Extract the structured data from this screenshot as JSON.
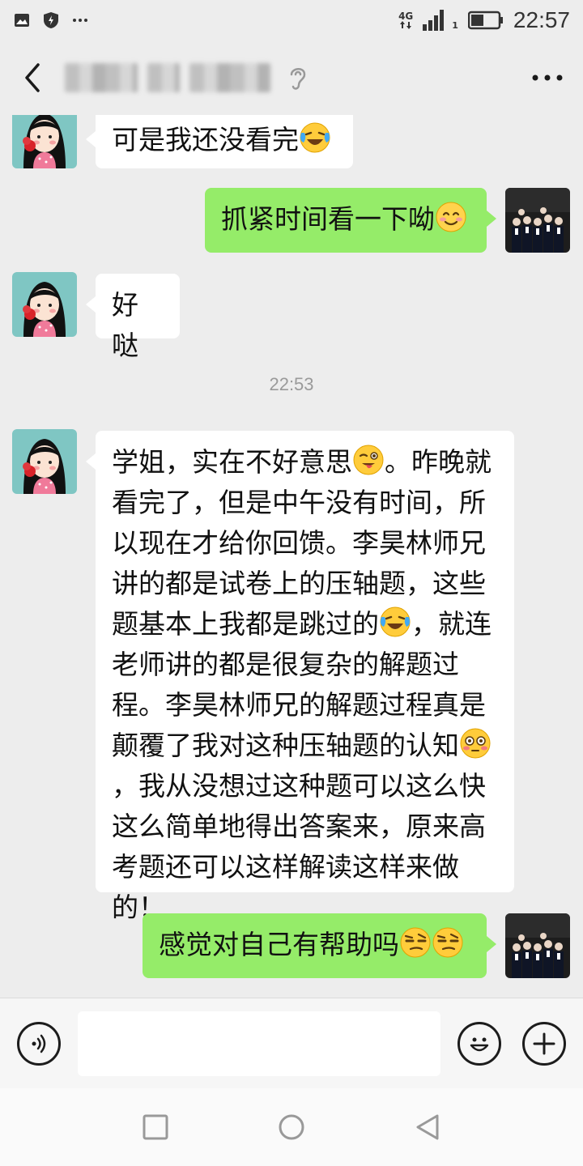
{
  "status_bar": {
    "left_icons": [
      "gallery-icon",
      "shield-bolt-icon",
      "more-dots-icon"
    ],
    "network": "4G",
    "signal_sub": "1",
    "time": "22:57"
  },
  "header": {
    "back_icon": "chevron-left-icon",
    "title_obscured": true,
    "ear_icon": "earpiece-icon",
    "more_icon": "ellipsis-icon"
  },
  "messages": [
    {
      "sender": "contact",
      "text": "可是我还没看完",
      "emoji": "crying-laughing"
    },
    {
      "sender": "me",
      "text": "抓紧时间看一下呦",
      "emoji": "smiling-blush"
    },
    {
      "sender": "contact",
      "text": "好哒"
    },
    {
      "type": "timestamp",
      "text": "22:53"
    },
    {
      "sender": "contact",
      "text_parts": [
        "学姐，实在不好意思",
        "。昨晚就看完了，但是中午没有时间，所以现在才给你回馈。李昊林师兄讲的都是试卷上的压轴题，这些题基本上我都是跳过的",
        "，就连老师讲的都是很复杂的解题过程。李昊林师兄的解题过程真是颠覆了我对这种压轴题的认知",
        "，我从没想过这种题可以这么快这么简单地得出答案来，原来高考题还可以这样解读这样来做的！"
      ],
      "emojis": [
        "winking-tongue",
        "crying-laughing",
        "flushed"
      ]
    },
    {
      "sender": "me",
      "text": "感觉对自己有帮助吗",
      "emoji": "raised-eyebrow"
    }
  ],
  "input_bar": {
    "voice_icon": "voice-icon",
    "placeholder": "",
    "emoji_icon": "smiley-icon",
    "plus_icon": "plus-icon"
  },
  "nav_bar": {
    "icons": [
      "recent-apps-icon",
      "home-icon",
      "back-triangle-icon"
    ]
  },
  "colors": {
    "background": "#ededed",
    "incoming_bubble": "#ffffff",
    "outgoing_bubble": "#95ec69",
    "timestamp": "#9a9a9a"
  }
}
